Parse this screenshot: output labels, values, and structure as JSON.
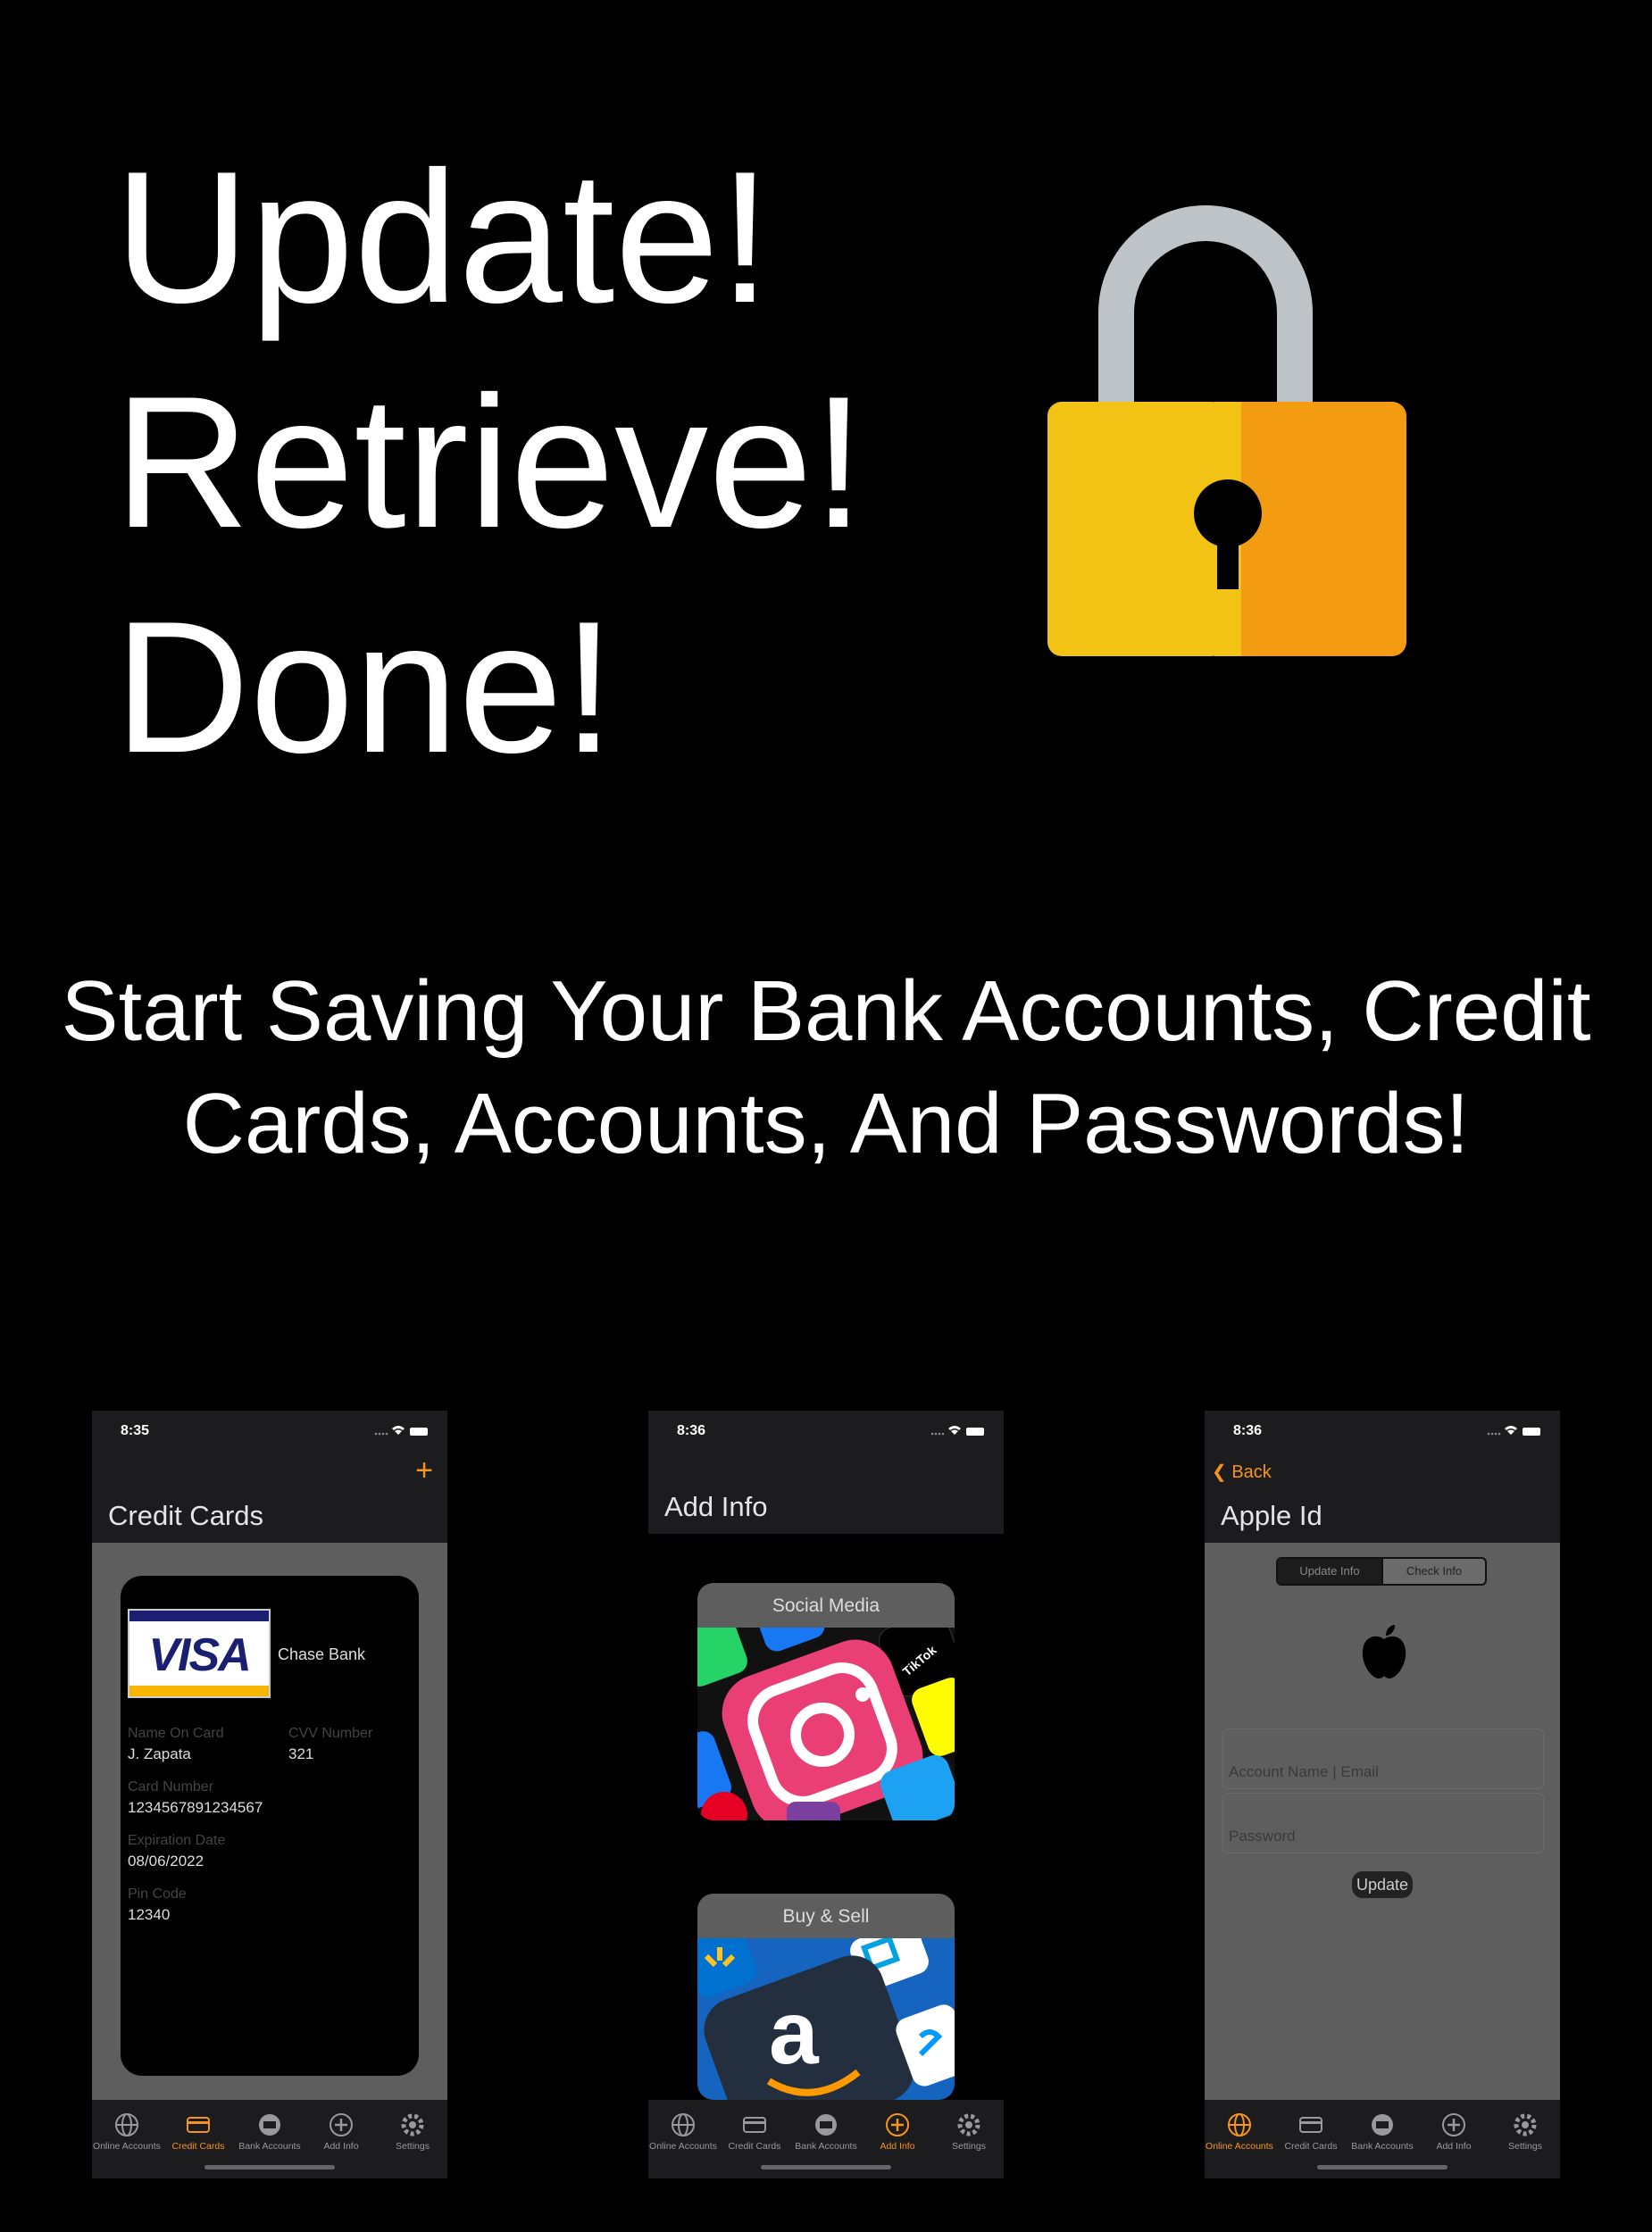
{
  "headline": {
    "line1": "Update!",
    "line2": "Retrieve!",
    "line3": "Done!"
  },
  "tagline": {
    "line1": "Start Saving Your Bank Accounts, Credit",
    "line2": "Cards, Accounts, And Passwords!"
  },
  "colors": {
    "accent": "#f7941d",
    "lock_left": "#f2c314",
    "lock_right": "#f39c12",
    "shackle": "#bdc3c7",
    "card_bg": "#000000"
  },
  "tabs": [
    "Online Accounts",
    "Credit Cards",
    "Bank Accounts",
    "Add Info",
    "Settings"
  ],
  "phone1": {
    "time": "8:35",
    "title": "Credit Cards",
    "add_icon": "plus-icon",
    "active_tab": "Credit Cards",
    "card": {
      "brand": "VISA",
      "bank": "Chase Bank",
      "name_label": "Name On Card",
      "name": "J. Zapata",
      "cvv_label": "CVV Number",
      "cvv": "321",
      "number_label": "Card Number",
      "number": "1234567891234567",
      "exp_label": "Expiration Date",
      "exp": "08/06/2022",
      "pin_label": "Pin Code",
      "pin": "12340"
    }
  },
  "phone2": {
    "time": "8:36",
    "title": "Add Info",
    "active_tab": "Add Info",
    "categories": [
      {
        "label": "Social Media",
        "tiktok": "TikTok"
      },
      {
        "label": "Buy & Sell"
      }
    ]
  },
  "phone3": {
    "time": "8:36",
    "back_label": "Back",
    "title": "Apple Id",
    "active_tab": "Online Accounts",
    "segments": [
      "Update Info",
      "Check Info"
    ],
    "account_placeholder": "Account Name | Email",
    "password_placeholder": "Password",
    "update_label": "Update"
  }
}
